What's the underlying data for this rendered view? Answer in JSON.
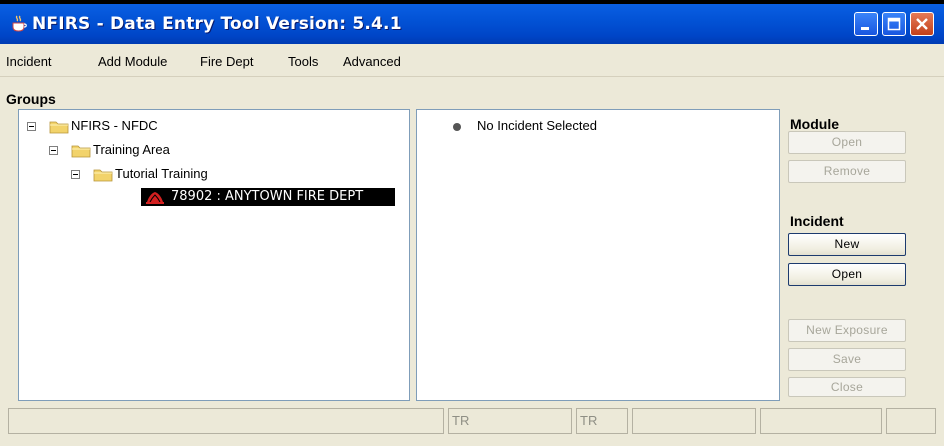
{
  "window": {
    "title": "NFIRS - Data Entry Tool Version: 5.4.1"
  },
  "menu": [
    "Incident",
    "Add Module",
    "Fire Dept",
    "Tools",
    "Advanced"
  ],
  "groups": {
    "label": "Groups",
    "tree": [
      {
        "label": "NFIRS - NFDC"
      },
      {
        "label": "Training Area"
      },
      {
        "label": "Tutorial Training"
      },
      {
        "label": "78902 : ANYTOWN FIRE DEPT"
      }
    ]
  },
  "incident_panel": {
    "message": "No Incident Selected"
  },
  "module_section": {
    "title": "Module",
    "buttons": [
      {
        "label": "Open",
        "enabled": false
      },
      {
        "label": "Remove",
        "enabled": false
      }
    ]
  },
  "incident_section": {
    "title": "Incident",
    "buttons": [
      {
        "label": "New",
        "enabled": true
      },
      {
        "label": "Open",
        "enabled": true
      },
      {
        "label": "New Exposure",
        "enabled": false
      },
      {
        "label": "Save",
        "enabled": false
      },
      {
        "label": "Close",
        "enabled": false
      }
    ]
  },
  "statusbar": [
    "",
    "TR",
    "TR",
    "",
    "",
    ""
  ],
  "icons": {
    "app": "java-cup-icon",
    "minimize": "minimize-icon",
    "maximize": "maximize-icon",
    "close": "close-icon",
    "folder": "folder-icon",
    "department": "fire-dept-icon"
  },
  "colors": {
    "titlebar": "#0054e3",
    "selection": "#000000",
    "department_icon": "#d42020"
  }
}
